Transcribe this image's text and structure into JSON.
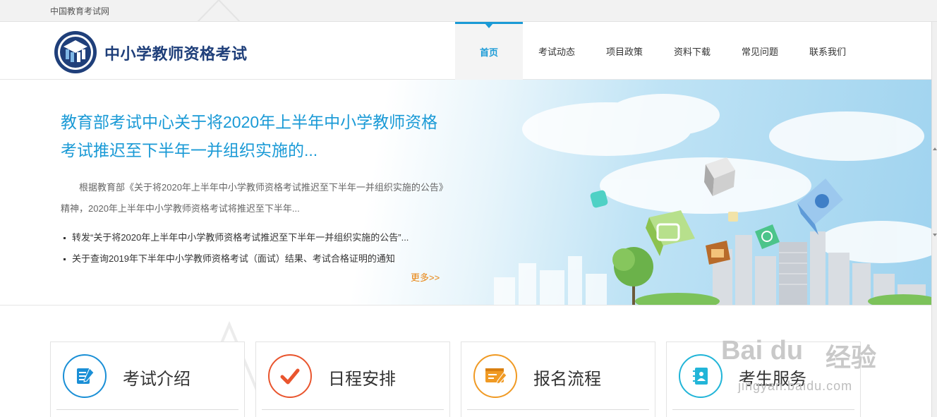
{
  "topbar": {
    "site_name": "中国教育考试网"
  },
  "header": {
    "brand": "中小学教师资格考试",
    "nav": [
      {
        "label": "首页",
        "active": true
      },
      {
        "label": "考试动态",
        "active": false
      },
      {
        "label": "项目政策",
        "active": false
      },
      {
        "label": "资料下载",
        "active": false
      },
      {
        "label": "常见问题",
        "active": false
      },
      {
        "label": "联系我们",
        "active": false
      }
    ]
  },
  "banner": {
    "headline": "教育部考试中心关于将2020年上半年中小学教师资格考试推迟至下半年一并组织实施的...",
    "summary": "根据教育部《关于将2020年上半年中小学教师资格考试推迟至下半年一并组织实施的公告》精神，2020年上半年中小学教师资格考试将推迟至下半年...",
    "news": [
      "转发“关于将2020年上半年中小学教师资格考试推迟至下半年一并组织实施的公告”...",
      "关于查询2019年下半年中小学教师资格考试（面试）结果、考试合格证明的通知"
    ],
    "more": "更多>>"
  },
  "cards": [
    {
      "title": "考试介绍",
      "icon": "document-pen-icon",
      "color": "#1a8fd6"
    },
    {
      "title": "日程安排",
      "icon": "checkmark-icon",
      "color": "#e9552e"
    },
    {
      "title": "报名流程",
      "icon": "form-pen-icon",
      "color": "#f09a24"
    },
    {
      "title": "考生服务",
      "icon": "address-book-icon",
      "color": "#22b5d8"
    }
  ],
  "watermark": {
    "logo": "Bai du",
    "cn": "经验",
    "url": "jingyan.baidu.com"
  },
  "colors": {
    "accent": "#1a9ad6",
    "brand": "#1f3f7a",
    "more": "#e8830f"
  }
}
